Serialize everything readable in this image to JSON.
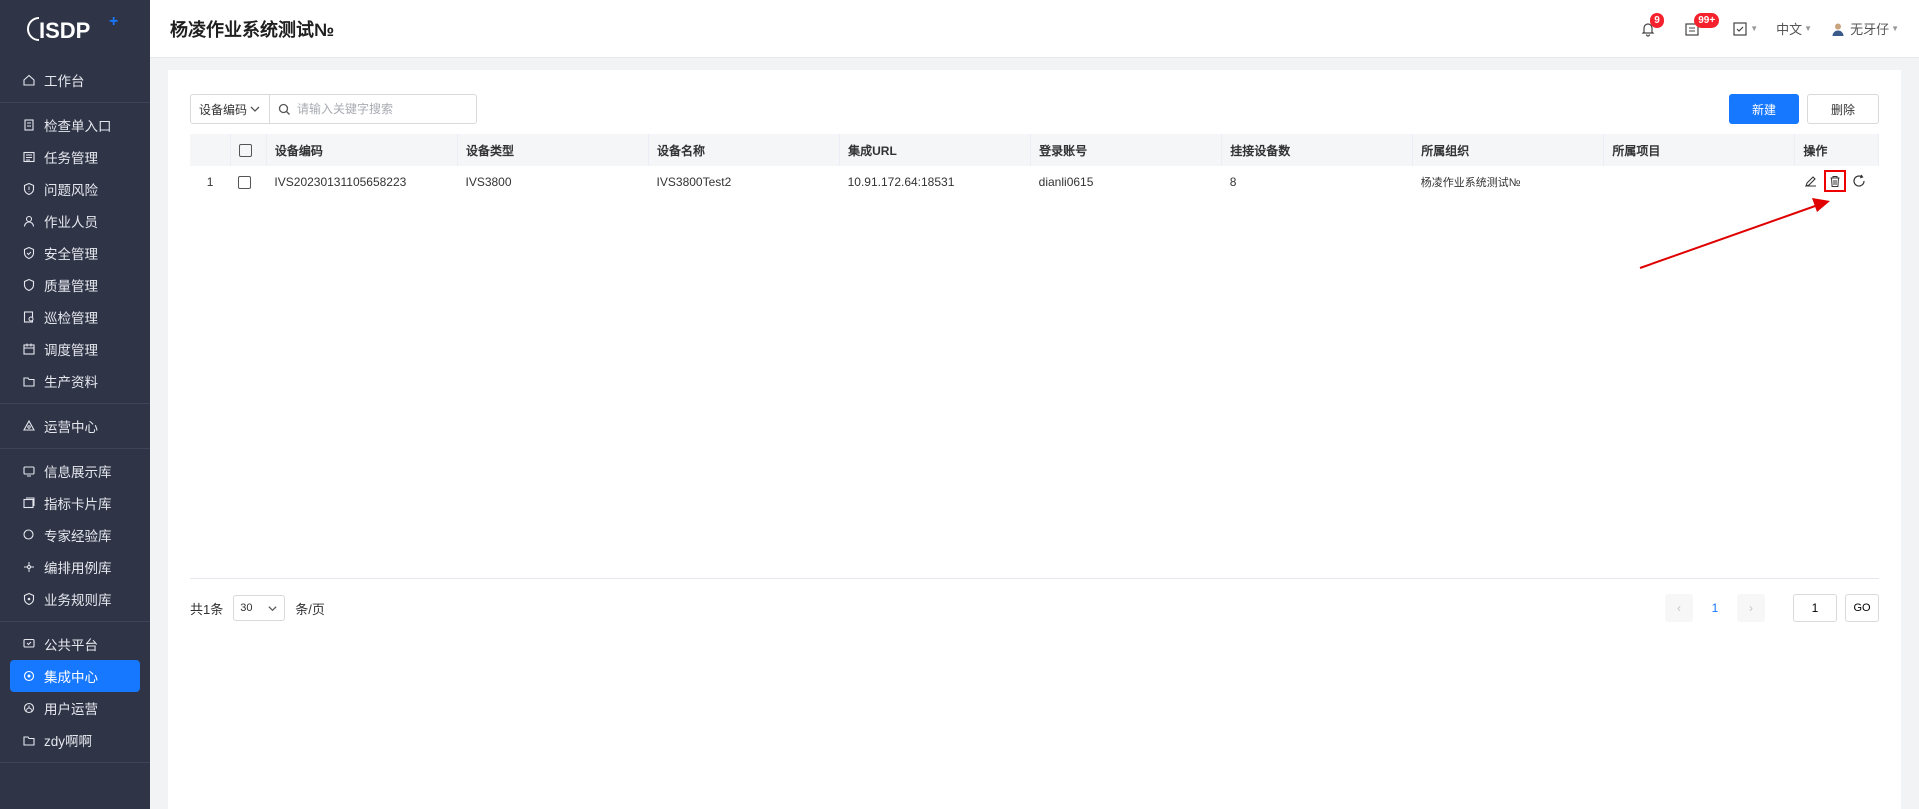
{
  "brand": {
    "logo_text": "ISDP",
    "logo_sup": "+"
  },
  "header": {
    "title": "杨凌作业系统测试№",
    "notifications_badge": "9",
    "messages_badge": "99+",
    "language": "中文",
    "user_name": "无牙仔"
  },
  "sidebar": {
    "groups": [
      [
        {
          "label": "工作台",
          "icon": "home-icon"
        }
      ],
      [
        {
          "label": "检查单入口",
          "icon": "clipboard-icon"
        },
        {
          "label": "任务管理",
          "icon": "task-icon"
        },
        {
          "label": "问题风险",
          "icon": "shield-alert-icon"
        },
        {
          "label": "作业人员",
          "icon": "user-icon"
        },
        {
          "label": "安全管理",
          "icon": "shield-check-icon"
        },
        {
          "label": "质量管理",
          "icon": "shield-icon"
        },
        {
          "label": "巡检管理",
          "icon": "inspect-icon"
        },
        {
          "label": "调度管理",
          "icon": "calendar-icon"
        },
        {
          "label": "生产资料",
          "icon": "folder-icon"
        }
      ],
      [
        {
          "label": "运营中心",
          "icon": "triangle-icon"
        }
      ],
      [
        {
          "label": "信息展示库",
          "icon": "display-icon"
        },
        {
          "label": "指标卡片库",
          "icon": "card-icon"
        },
        {
          "label": "专家经验库",
          "icon": "search-icon"
        },
        {
          "label": "编排用例库",
          "icon": "flow-icon"
        },
        {
          "label": "业务规则库",
          "icon": "rule-icon"
        }
      ],
      [
        {
          "label": "公共平台",
          "icon": "monitor-icon"
        },
        {
          "label": "集成中心",
          "icon": "integration-icon",
          "active": true
        },
        {
          "label": "用户运营",
          "icon": "users-icon"
        },
        {
          "label": "zdy啊啊",
          "icon": "folder-icon"
        }
      ]
    ]
  },
  "toolbar": {
    "filter_select": "设备编码",
    "search_placeholder": "请输入关键字搜索",
    "new_label": "新建",
    "delete_label": "删除"
  },
  "table": {
    "columns": [
      "设备编码",
      "设备类型",
      "设备名称",
      "集成URL",
      "登录账号",
      "挂接设备数",
      "所属组织",
      "所属项目",
      "操作"
    ],
    "rows": [
      {
        "index": "1",
        "code": "IVS20230131105658223",
        "type": "IVS3800",
        "name": "IVS3800Test2",
        "url": "10.91.172.64:18531",
        "account": "dianli0615",
        "device_count": "8",
        "org": "杨凌作业系统测试№",
        "project": ""
      }
    ]
  },
  "pagination": {
    "total_prefix": "共1条",
    "page_size": "30",
    "page_size_suffix": "条/页",
    "current_page": "1",
    "jump_value": "1",
    "go_label": "GO"
  },
  "colors": {
    "primary": "#1677ff",
    "sidebar": "#2f3447",
    "badge": "#f5222d",
    "annotation": "#e00000"
  }
}
